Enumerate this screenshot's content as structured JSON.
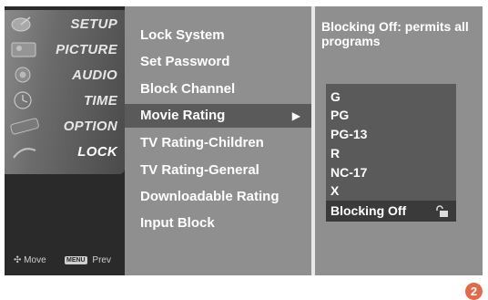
{
  "left_menu": {
    "categories": [
      {
        "label": "SETUP",
        "icon": "satellite-dish-icon"
      },
      {
        "label": "PICTURE",
        "icon": "picture-icon"
      },
      {
        "label": "AUDIO",
        "icon": "speaker-icon"
      },
      {
        "label": "TIME",
        "icon": "clock-icon"
      },
      {
        "label": "OPTION",
        "icon": "option-icon"
      },
      {
        "label": "LOCK",
        "icon": "lock-icon"
      }
    ],
    "active": "LOCK",
    "hint_move": "Move",
    "hint_menu_key": "MENU",
    "hint_prev": "Prev"
  },
  "lock_menu": {
    "items": [
      {
        "label": "Lock System"
      },
      {
        "label": "Set Password"
      },
      {
        "label": "Block Channel"
      },
      {
        "label": "Movie Rating",
        "arrow": "▶"
      },
      {
        "label": "TV Rating-Children"
      },
      {
        "label": "TV Rating-General"
      },
      {
        "label": "Downloadable Rating"
      },
      {
        "label": "Input Block"
      }
    ],
    "selected": "Movie Rating"
  },
  "movie_rating": {
    "description": "Blocking Off: permits all programs",
    "options": [
      "G",
      "PG",
      "PG-13",
      "R",
      "NC-17",
      "X"
    ],
    "selected_option": "Blocking Off",
    "selected_icon": "unlocked-icon"
  },
  "page_badge": "2",
  "colors": {
    "panel": "#8f8f8f",
    "dark": "#2a2a2a",
    "selected": "#5a5a5a",
    "badge": "#e06a4a"
  }
}
